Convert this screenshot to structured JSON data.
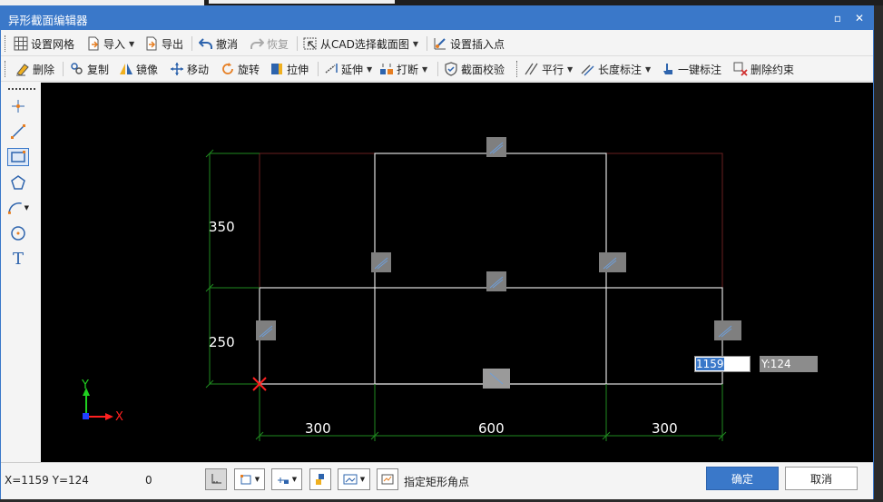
{
  "window": {
    "title": "异形截面编辑器",
    "minimize_glyph": "▫",
    "close_glyph": "✕"
  },
  "toolbar1": {
    "grid_label": "设置网格",
    "import_label": "导入",
    "export_label": "导出",
    "undo_label": "撤消",
    "redo_label": "恢复",
    "cad_select_label": "从CAD选择截面图",
    "insert_point_label": "设置插入点"
  },
  "toolbar2": {
    "delete_label": "删除",
    "copy_label": "复制",
    "mirror_label": "镜像",
    "move_label": "移动",
    "rotate_label": "旋转",
    "stretch_label": "拉伸",
    "extend_label": "延伸",
    "break_label": "打断",
    "verify_label": "截面校验",
    "parallel_label": "平行",
    "length_dim_label": "长度标注",
    "one_click_dim_label": "一键标注",
    "delete_constraint_label": "删除约束"
  },
  "left_tools": [
    "point-tool",
    "line-tool",
    "rectangle-tool",
    "polygon-tool",
    "arc-tool",
    "circle-tool",
    "text-tool"
  ],
  "text_tool_glyph": "T",
  "canvas": {
    "dimensions": {
      "height_top": "350",
      "height_bottom": "250",
      "width_left": "300",
      "width_middle": "600",
      "width_right": "300"
    },
    "axis": {
      "x_label": "X",
      "y_label": "Y"
    },
    "input_x_value": "1159",
    "input_y_value": "Y:124"
  },
  "status": {
    "coordinates": "X=1159 Y=124",
    "count": "0",
    "hint": "指定矩形角点",
    "ok_label": "确定",
    "cancel_label": "取消"
  },
  "colors": {
    "accent": "#3a78c9",
    "canvas_bg": "#000000",
    "dim_green": "#1f8a1f",
    "shape_white": "#ffffff",
    "shape_red": "#7a2a2a"
  }
}
